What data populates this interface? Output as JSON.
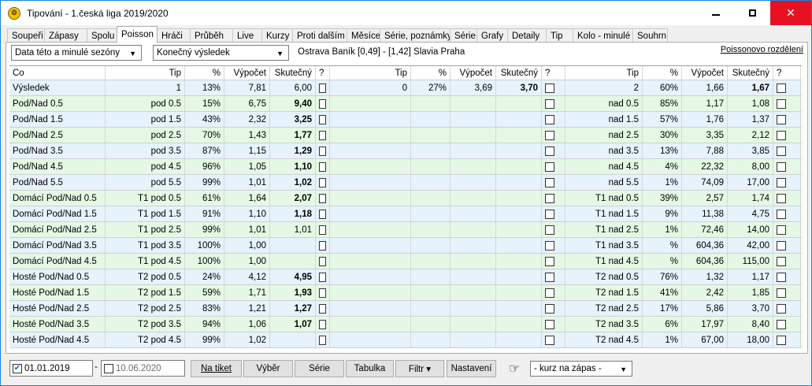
{
  "window": {
    "title": "Tipování - 1.česká liga 2019/2020",
    "minimize": "—",
    "maximize": "☐",
    "close": "✕"
  },
  "tabs": [
    "Soupeři",
    "Zápasy",
    "Spolu",
    "Poisson",
    "Hráči",
    "Průběh",
    "Live",
    "Kurzy",
    "Proti dalším",
    "Měsíce",
    "Série, poznámky",
    "Série",
    "Grafy",
    "Detaily",
    "Tip",
    "Kolo - minulé",
    "Souhrn"
  ],
  "active_tab": "Poisson",
  "filters": {
    "data_select": "Data této a minulé sezóny",
    "result_select": "Konečný výsledek"
  },
  "match_info": "Ostrava Baník [0,49] - [1,42] Slavia Praha",
  "poisson_link": "Poissonovo rozdělení",
  "columns": {
    "co": "Co",
    "tip": "Tip",
    "pct": "%",
    "calc": "Výpočet",
    "actual": "Skutečný",
    "q": "?"
  },
  "rows": [
    {
      "co": "Výsledek",
      "t1": "1",
      "p1": "13%",
      "v1": "7,81",
      "s1": "6,00",
      "b1": false,
      "t2": "0",
      "p2": "27%",
      "v2": "3,69",
      "s2": "3,70",
      "b2": true,
      "t3": "2",
      "p3": "60%",
      "v3": "1,66",
      "s3": "1,67",
      "b3": true
    },
    {
      "co": "Pod/Nad 0.5",
      "t1": "pod 0.5",
      "p1": "15%",
      "v1": "6,75",
      "s1": "9,40",
      "b1": true,
      "t2": "",
      "p2": "",
      "v2": "",
      "s2": "",
      "b2": false,
      "t3": "nad 0.5",
      "p3": "85%",
      "v3": "1,17",
      "s3": "1,08",
      "b3": false
    },
    {
      "co": "Pod/Nad 1.5",
      "t1": "pod 1.5",
      "p1": "43%",
      "v1": "2,32",
      "s1": "3,25",
      "b1": true,
      "t2": "",
      "p2": "",
      "v2": "",
      "s2": "",
      "b2": false,
      "t3": "nad 1.5",
      "p3": "57%",
      "v3": "1,76",
      "s3": "1,37",
      "b3": false
    },
    {
      "co": "Pod/Nad 2.5",
      "t1": "pod 2.5",
      "p1": "70%",
      "v1": "1,43",
      "s1": "1,77",
      "b1": true,
      "t2": "",
      "p2": "",
      "v2": "",
      "s2": "",
      "b2": false,
      "t3": "nad 2.5",
      "p3": "30%",
      "v3": "3,35",
      "s3": "2,12",
      "b3": false
    },
    {
      "co": "Pod/Nad 3.5",
      "t1": "pod 3.5",
      "p1": "87%",
      "v1": "1,15",
      "s1": "1,29",
      "b1": true,
      "t2": "",
      "p2": "",
      "v2": "",
      "s2": "",
      "b2": false,
      "t3": "nad 3.5",
      "p3": "13%",
      "v3": "7,88",
      "s3": "3,85",
      "b3": false
    },
    {
      "co": "Pod/Nad 4.5",
      "t1": "pod 4.5",
      "p1": "96%",
      "v1": "1,05",
      "s1": "1,10",
      "b1": true,
      "t2": "",
      "p2": "",
      "v2": "",
      "s2": "",
      "b2": false,
      "t3": "nad 4.5",
      "p3": "4%",
      "v3": "22,32",
      "s3": "8,00",
      "b3": false
    },
    {
      "co": "Pod/Nad 5.5",
      "t1": "pod 5.5",
      "p1": "99%",
      "v1": "1,01",
      "s1": "1,02",
      "b1": true,
      "t2": "",
      "p2": "",
      "v2": "",
      "s2": "",
      "b2": false,
      "t3": "nad 5.5",
      "p3": "1%",
      "v3": "74,09",
      "s3": "17,00",
      "b3": false
    },
    {
      "co": "Domácí Pod/Nad 0.5",
      "t1": "T1 pod 0.5",
      "p1": "61%",
      "v1": "1,64",
      "s1": "2,07",
      "b1": true,
      "t2": "",
      "p2": "",
      "v2": "",
      "s2": "",
      "b2": false,
      "t3": "T1 nad 0.5",
      "p3": "39%",
      "v3": "2,57",
      "s3": "1,74",
      "b3": false
    },
    {
      "co": "Domácí Pod/Nad 1.5",
      "t1": "T1 pod 1.5",
      "p1": "91%",
      "v1": "1,10",
      "s1": "1,18",
      "b1": true,
      "t2": "",
      "p2": "",
      "v2": "",
      "s2": "",
      "b2": false,
      "t3": "T1 nad 1.5",
      "p3": "9%",
      "v3": "11,38",
      "s3": "4,75",
      "b3": false
    },
    {
      "co": "Domácí Pod/Nad 2.5",
      "t1": "T1 pod 2.5",
      "p1": "99%",
      "v1": "1,01",
      "s1": "1,01",
      "b1": false,
      "t2": "",
      "p2": "",
      "v2": "",
      "s2": "",
      "b2": false,
      "t3": "T1 nad 2.5",
      "p3": "1%",
      "v3": "72,46",
      "s3": "14,00",
      "b3": false
    },
    {
      "co": "Domácí Pod/Nad 3.5",
      "t1": "T1 pod 3.5",
      "p1": "100%",
      "v1": "1,00",
      "s1": "",
      "b1": false,
      "t2": "",
      "p2": "",
      "v2": "",
      "s2": "",
      "b2": false,
      "t3": "T1 nad 3.5",
      "p3": "%",
      "v3": "604,36",
      "s3": "42,00",
      "b3": false
    },
    {
      "co": "Domácí Pod/Nad 4.5",
      "t1": "T1 pod 4.5",
      "p1": "100%",
      "v1": "1,00",
      "s1": "",
      "b1": false,
      "t2": "",
      "p2": "",
      "v2": "",
      "s2": "",
      "b2": false,
      "t3": "T1 nad 4.5",
      "p3": "%",
      "v3": "604,36",
      "s3": "115,00",
      "b3": false
    },
    {
      "co": "Hosté Pod/Nad 0.5",
      "t1": "T2 pod 0.5",
      "p1": "24%",
      "v1": "4,12",
      "s1": "4,95",
      "b1": true,
      "t2": "",
      "p2": "",
      "v2": "",
      "s2": "",
      "b2": false,
      "t3": "T2 nad 0.5",
      "p3": "76%",
      "v3": "1,32",
      "s3": "1,17",
      "b3": false
    },
    {
      "co": "Hosté Pod/Nad 1.5",
      "t1": "T2 pod 1.5",
      "p1": "59%",
      "v1": "1,71",
      "s1": "1,93",
      "b1": true,
      "t2": "",
      "p2": "",
      "v2": "",
      "s2": "",
      "b2": false,
      "t3": "T2 nad 1.5",
      "p3": "41%",
      "v3": "2,42",
      "s3": "1,85",
      "b3": false
    },
    {
      "co": "Hosté Pod/Nad 2.5",
      "t1": "T2 pod 2.5",
      "p1": "83%",
      "v1": "1,21",
      "s1": "1,27",
      "b1": true,
      "t2": "",
      "p2": "",
      "v2": "",
      "s2": "",
      "b2": false,
      "t3": "T2 nad 2.5",
      "p3": "17%",
      "v3": "5,86",
      "s3": "3,70",
      "b3": false
    },
    {
      "co": "Hosté Pod/Nad 3.5",
      "t1": "T2 pod 3.5",
      "p1": "94%",
      "v1": "1,06",
      "s1": "1,07",
      "b1": true,
      "t2": "",
      "p2": "",
      "v2": "",
      "s2": "",
      "b2": false,
      "t3": "T2 nad 3.5",
      "p3": "6%",
      "v3": "17,97",
      "s3": "8,40",
      "b3": false
    },
    {
      "co": "Hosté Pod/Nad 4.5",
      "t1": "T2 pod 4.5",
      "p1": "99%",
      "v1": "1,02",
      "s1": "",
      "b1": false,
      "t2": "",
      "p2": "",
      "v2": "",
      "s2": "",
      "b2": false,
      "t3": "T2 nad 4.5",
      "p3": "1%",
      "v3": "67,00",
      "s3": "18,00",
      "b3": false
    }
  ],
  "bottom": {
    "date_from": "01.01.2019",
    "date_from_checked": true,
    "separator": "-",
    "date_to": "10.06.2020",
    "date_to_checked": false,
    "buttons": [
      "Na tiket",
      "Výběr",
      "Série",
      "Tabulka",
      "Filtr ▾",
      "Nastavení"
    ],
    "hand_icon": "☞",
    "odds_select": "- kurz na zápas -"
  },
  "colors": {
    "row_blue": "#e6f2fc",
    "row_green": "#e5f8e5",
    "close_red": "#e81123"
  }
}
